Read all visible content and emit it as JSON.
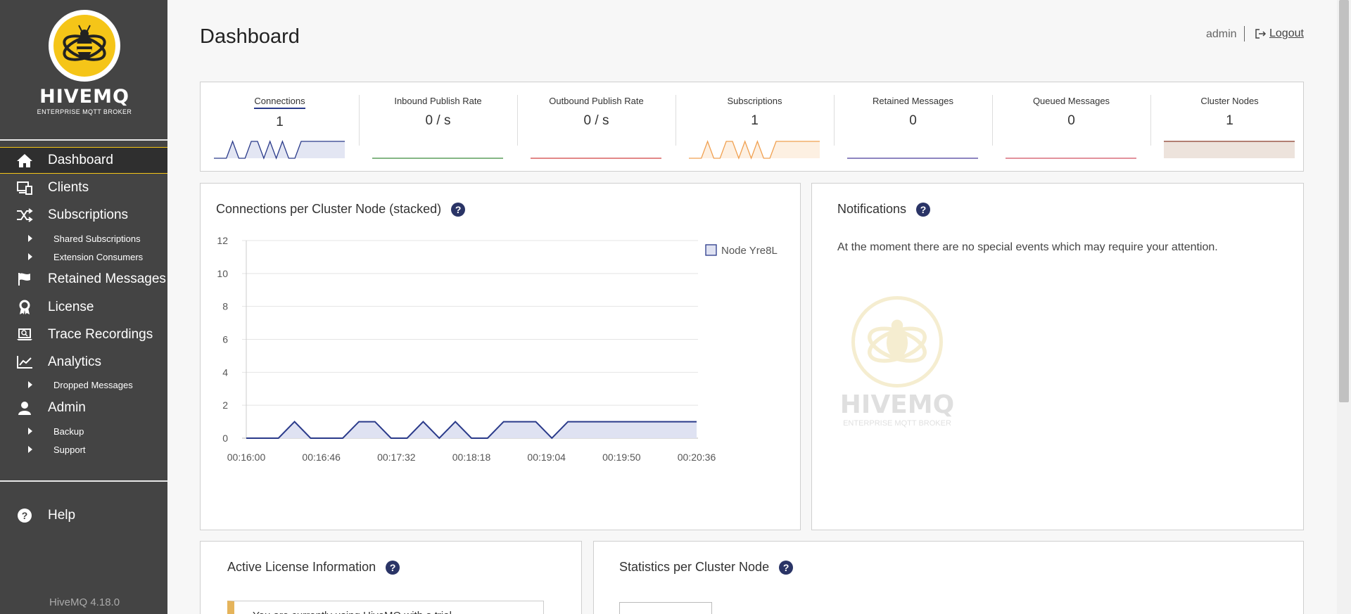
{
  "app": {
    "logo_name": "HIVEMQ",
    "logo_tagline": "ENTERPRISE MQTT BROKER",
    "version": "HiveMQ 4.18.0"
  },
  "sidebar": {
    "items": [
      {
        "label": "Dashboard",
        "icon": "home-icon",
        "active": true
      },
      {
        "label": "Clients",
        "icon": "monitor-icon"
      },
      {
        "label": "Subscriptions",
        "icon": "shuffle-icon"
      },
      {
        "label": "Shared Subscriptions",
        "sub": true
      },
      {
        "label": "Extension Consumers",
        "sub": true
      },
      {
        "label": "Retained Messages",
        "icon": "flag-icon"
      },
      {
        "label": "License",
        "icon": "award-icon"
      },
      {
        "label": "Trace Recordings",
        "icon": "laptop-search-icon"
      },
      {
        "label": "Analytics",
        "icon": "line-chart-icon"
      },
      {
        "label": "Dropped Messages",
        "sub": true
      },
      {
        "label": "Admin",
        "icon": "user-icon"
      },
      {
        "label": "Backup",
        "sub": true
      },
      {
        "label": "Support",
        "sub": true
      }
    ],
    "help": "Help"
  },
  "header": {
    "title": "Dashboard",
    "user": "admin",
    "logout": "Logout"
  },
  "stats": [
    {
      "label": "Connections",
      "value": "1",
      "color": "#2a3a8a",
      "fill": "#e3e6f3",
      "active": true
    },
    {
      "label": "Inbound Publish Rate",
      "value": "0 / s",
      "color": "#3a8a3a",
      "fill": "#ffffff"
    },
    {
      "label": "Outbound Publish Rate",
      "value": "0 / s",
      "color": "#d04040",
      "fill": "#ffffff"
    },
    {
      "label": "Subscriptions",
      "value": "1",
      "color": "#f0a050",
      "fill": "#fdf0e2"
    },
    {
      "label": "Retained Messages",
      "value": "0",
      "color": "#4a3a9a",
      "fill": "#ffffff"
    },
    {
      "label": "Queued Messages",
      "value": "0",
      "color": "#d05060",
      "fill": "#ffffff"
    },
    {
      "label": "Cluster Nodes",
      "value": "1",
      "color": "#8a3a2a",
      "fill": "#ede3dc"
    }
  ],
  "connections_card": {
    "title": "Connections per Cluster Node (stacked)"
  },
  "notifications": {
    "title": "Notifications",
    "message": "At the moment there are no special events which may require your attention.",
    "watermark_name": "HIVEMQ",
    "watermark_tagline": "ENTERPRISE MQTT BROKER"
  },
  "license_card": {
    "title": "Active License Information",
    "notice": "You are currently using HiveMQ with a trial"
  },
  "stats_card": {
    "title": "Statistics per Cluster Node"
  },
  "chart_data": {
    "type": "area",
    "title": "Connections per Cluster Node (stacked)",
    "x": [
      "00:16:00",
      "00:16:46",
      "00:17:32",
      "00:18:18",
      "00:19:04",
      "00:19:50",
      "00:20:36"
    ],
    "ylim": [
      0,
      12
    ],
    "yticks": [
      0,
      2,
      4,
      6,
      8,
      10,
      12
    ],
    "series": [
      {
        "name": "Node Yre8L",
        "color": "#2a3a8a",
        "fill": "#dfe2f2",
        "points": [
          [
            0,
            0
          ],
          [
            20,
            0
          ],
          [
            30,
            1
          ],
          [
            40,
            0
          ],
          [
            60,
            0
          ],
          [
            70,
            1
          ],
          [
            80,
            1
          ],
          [
            90,
            0
          ],
          [
            100,
            0
          ],
          [
            110,
            1
          ],
          [
            120,
            0
          ],
          [
            130,
            1
          ],
          [
            140,
            0
          ],
          [
            150,
            0
          ],
          [
            160,
            1
          ],
          [
            170,
            1
          ],
          [
            180,
            1
          ],
          [
            190,
            0
          ],
          [
            200,
            1
          ],
          [
            210,
            1
          ],
          [
            220,
            1
          ],
          [
            230,
            1
          ],
          [
            240,
            1
          ],
          [
            250,
            1
          ],
          [
            260,
            1
          ],
          [
            270,
            1
          ],
          [
            280,
            1
          ]
        ]
      }
    ],
    "legend": "top-right"
  },
  "sparklines": {
    "connections": [
      0,
      0,
      0,
      1,
      0,
      0,
      1,
      1,
      0,
      1,
      0,
      1,
      0,
      0,
      1,
      1,
      1,
      1,
      1,
      1,
      1,
      1
    ],
    "inbound": [
      0,
      0,
      0,
      0,
      0,
      0,
      0,
      0,
      0,
      0,
      0,
      0,
      0,
      0,
      0,
      0,
      0,
      0,
      0,
      0,
      0,
      0
    ],
    "outbound": [
      0,
      0,
      0,
      0,
      0,
      0,
      0,
      0,
      0,
      0,
      0,
      0,
      0,
      0,
      0,
      0,
      0,
      0,
      0,
      0,
      0,
      0
    ],
    "subscriptions": [
      0,
      0,
      0,
      1,
      0,
      0,
      1,
      1,
      0,
      1,
      0,
      1,
      0,
      0,
      1,
      1,
      1,
      1,
      1,
      1,
      1,
      1
    ],
    "retained": [
      0,
      0,
      0,
      0,
      0,
      0,
      0,
      0,
      0,
      0,
      0,
      0,
      0,
      0,
      0,
      0,
      0,
      0,
      0,
      0,
      0,
      0
    ],
    "queued": [
      0,
      0,
      0,
      0,
      0,
      0,
      0,
      0,
      0,
      0,
      0,
      0,
      0,
      0,
      0,
      0,
      0,
      0,
      0,
      0,
      0,
      0
    ],
    "cluster": [
      1,
      1,
      1,
      1,
      1,
      1,
      1,
      1,
      1,
      1,
      1,
      1,
      1,
      1,
      1,
      1,
      1,
      1,
      1,
      1,
      1,
      1
    ]
  }
}
